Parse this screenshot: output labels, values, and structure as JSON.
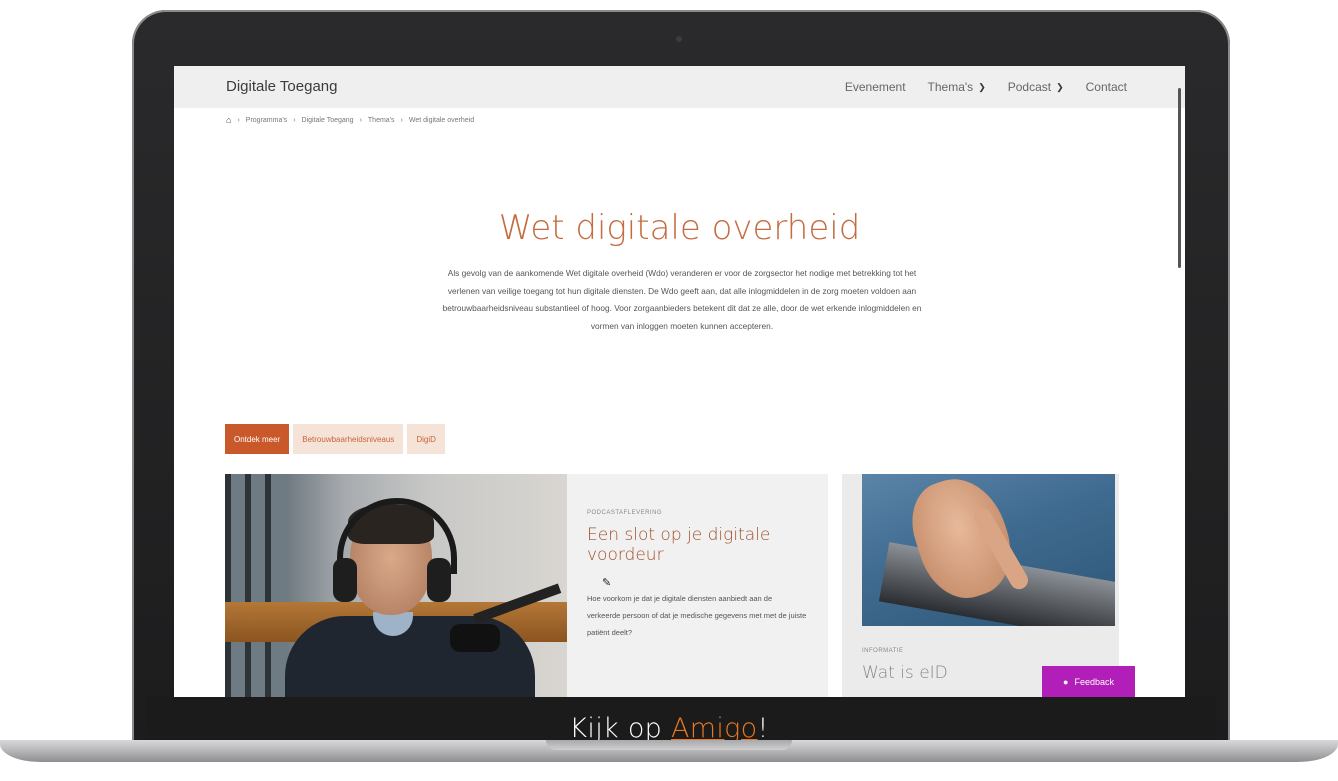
{
  "site": {
    "name": "Digitale Toegang",
    "nav": [
      {
        "label": "Evenement",
        "has_dropdown": false
      },
      {
        "label": "Thema's",
        "has_dropdown": true
      },
      {
        "label": "Podcast",
        "has_dropdown": true
      },
      {
        "label": "Contact",
        "has_dropdown": false
      }
    ],
    "breadcrumb": [
      "Programma's",
      "Digitale Toegang",
      "Thema's",
      "Wet digitale overheid"
    ]
  },
  "hero": {
    "title": "Wet digitale overheid",
    "text": "Als gevolg van de aankomende Wet digitale overheid (Wdo) veranderen er voor de zorgsector het nodige met betrekking tot het verlenen van veilige toegang tot hun digitale diensten. De Wdo geeft aan, dat alle inlogmiddelen in de zorg moeten voldoen aan betrouwbaarheidsniveau substantieel of hoog. Voor zorgaanbieders betekent dit dat ze alle, door de wet erkende inlogmiddelen en vormen van inloggen moeten kunnen accepteren."
  },
  "tabs": [
    {
      "label": "Ontdek meer",
      "active": true
    },
    {
      "label": "Betrouwbaarheidsniveaus",
      "active": false
    },
    {
      "label": "DigiD",
      "active": false
    }
  ],
  "cards": [
    {
      "label": "PODCASTAFLEVERING",
      "title": "Een slot op je digitale voordeur",
      "description": "Hoe voorkom je dat je digitale diensten aanbiedt aan de verkeerde persoon of dat je medische gegevens met met de juiste patiënt deelt?"
    },
    {
      "label": "INFORMATIE",
      "title": "Wat is eID"
    }
  ],
  "feedback_button": "Feedback",
  "caption": {
    "prefix": "Kijk op ",
    "link": "Amigo",
    "suffix": "!"
  },
  "colors": {
    "accent": "#c9582a",
    "title": "#c56b3f",
    "feedback": "#b21fb8",
    "caption_link": "#e87722"
  }
}
